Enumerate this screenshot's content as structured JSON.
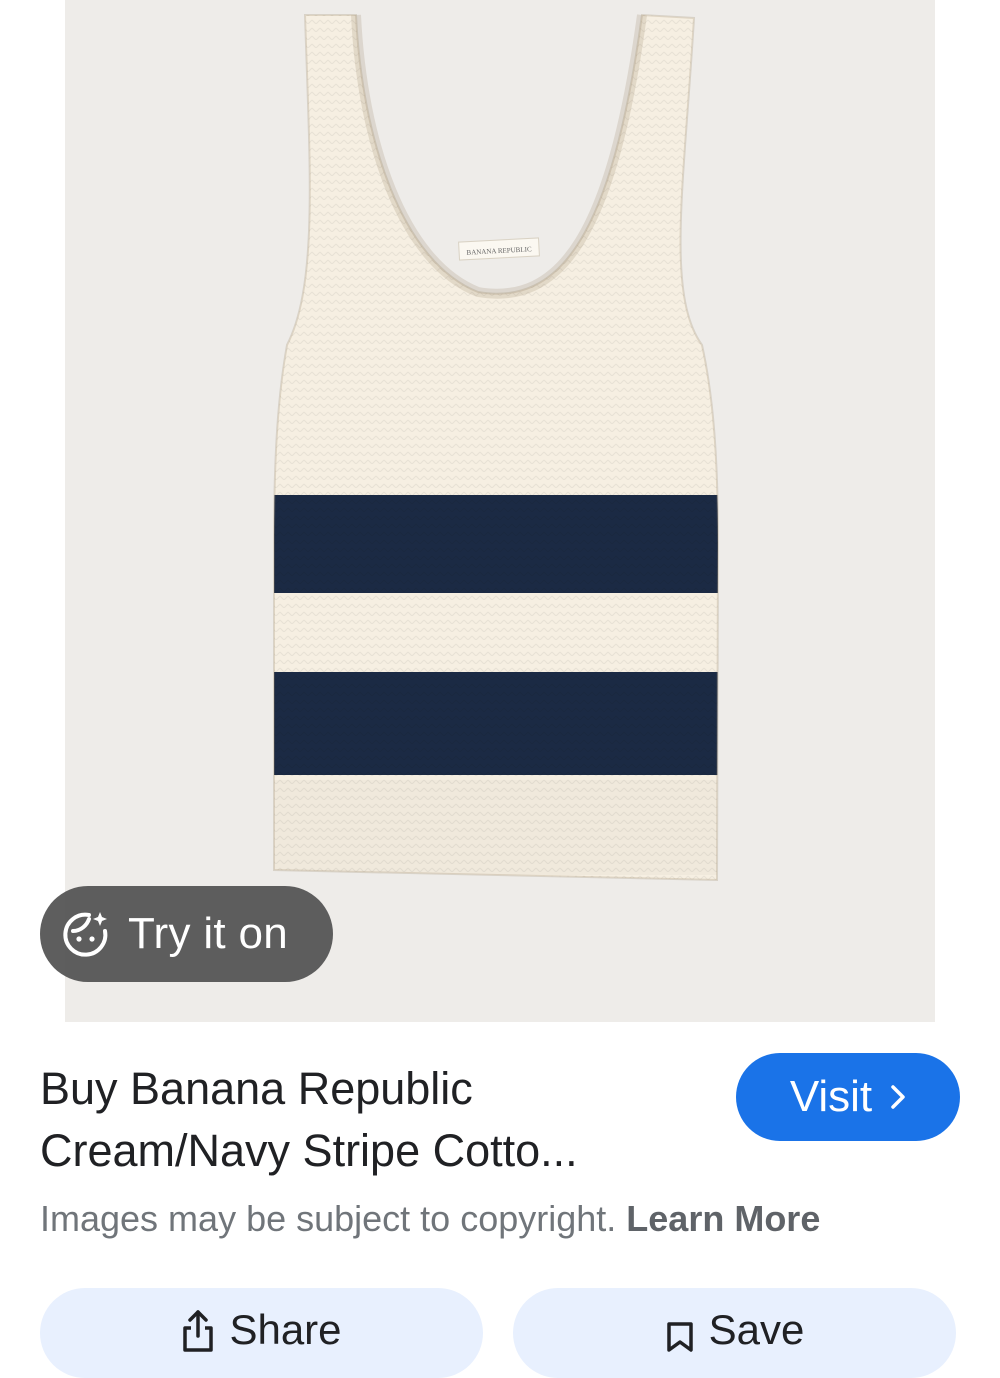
{
  "product_image": {
    "brand_tag": "BANANA REPUBLIC",
    "colors": {
      "background": "#eeece9",
      "cream": "#f6efe2",
      "navy": "#1b2a44"
    }
  },
  "try_on": {
    "label": "Try it on",
    "icon": "try-on-face-sparkle-icon"
  },
  "result": {
    "title_line1": "Buy Banana Republic",
    "title_line2": "Cream/Navy Stripe Cotto...",
    "visit_label": "Visit",
    "visit_icon": "chevron-right-icon"
  },
  "copyright": {
    "text": "Images may be subject to copyright.",
    "link": "Learn More"
  },
  "actions": {
    "share_label": "Share",
    "share_icon": "share-icon",
    "save_label": "Save",
    "save_icon": "bookmark-icon"
  },
  "theme": {
    "accent": "#1a73e8",
    "chip_bg": "#e8f0fe",
    "text": "#202124",
    "muted": "#70757a"
  }
}
